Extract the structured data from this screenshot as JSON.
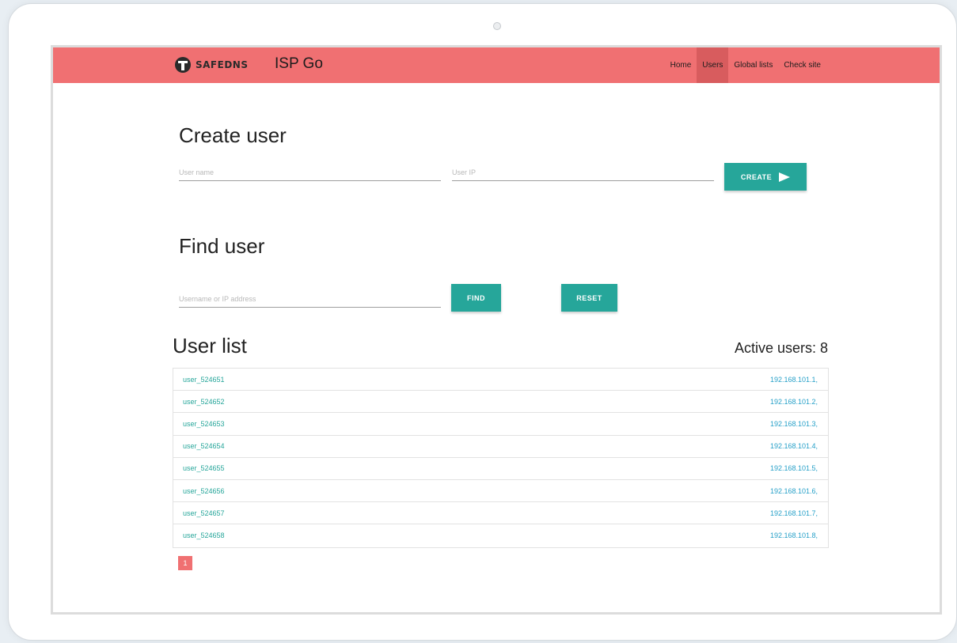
{
  "nav": {
    "logo_text": "SAFEDNS",
    "app_title": "ISP Go",
    "links": [
      {
        "label": "Home"
      },
      {
        "label": "Users"
      },
      {
        "label": "Global lists"
      },
      {
        "label": "Check site"
      }
    ],
    "active": "Users"
  },
  "create": {
    "heading": "Create user",
    "username_placeholder": "User name",
    "ip_placeholder": "User IP",
    "button": "CREATE",
    "button_icon": "send-icon"
  },
  "find": {
    "heading": "Find user",
    "search_placeholder": "Username or IP address",
    "find_button": "FIND",
    "reset_button": "RESET"
  },
  "list": {
    "heading": "User list",
    "active_users": "Active users: 8",
    "users": [
      {
        "name": "user_524651",
        "ip": "192.168.101.1,"
      },
      {
        "name": "user_524652",
        "ip": "192.168.101.2,"
      },
      {
        "name": "user_524653",
        "ip": "192.168.101.3,"
      },
      {
        "name": "user_524654",
        "ip": "192.168.101.4,"
      },
      {
        "name": "user_524655",
        "ip": "192.168.101.5,"
      },
      {
        "name": "user_524656",
        "ip": "192.168.101.6,"
      },
      {
        "name": "user_524657",
        "ip": "192.168.101.7,"
      },
      {
        "name": "user_524658",
        "ip": "192.168.101.8,"
      }
    ]
  },
  "pagination": {
    "current": "1"
  },
  "colors": {
    "navbar": "#f07072",
    "nav_active": "#d85c5e",
    "button": "#26a69a",
    "username_link": "#26a69a",
    "ip_link": "#26a0c8"
  }
}
